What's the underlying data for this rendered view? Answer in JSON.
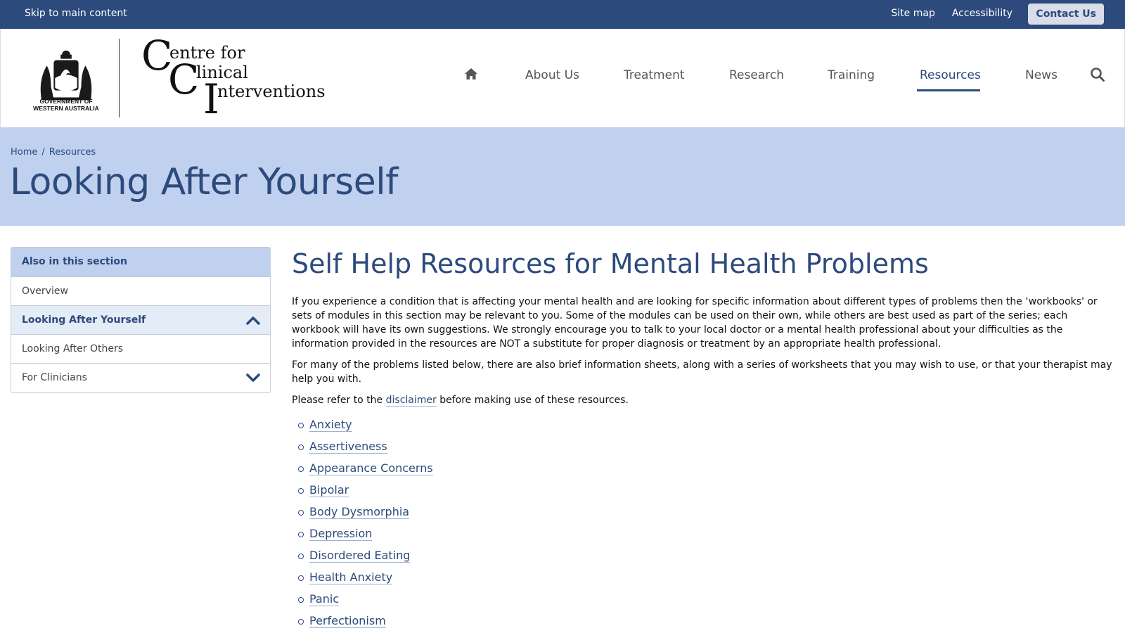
{
  "topbar": {
    "skip_link": "Skip to main content",
    "site_map": "Site map",
    "accessibility": "Accessibility",
    "contact": "Contact Us"
  },
  "logo": {
    "government_line1": "GOVERNMENT OF",
    "government_line2": "WESTERN AUSTRALIA",
    "cci_letter1": "C",
    "cci_line1": "entre for",
    "cci_letter2": "C",
    "cci_line2": "linical",
    "cci_letter3": "I",
    "cci_line3": "nterventions"
  },
  "nav": {
    "icons": [
      "home-icon",
      "search-icon"
    ],
    "items": [
      "About Us",
      "Treatment",
      "Research",
      "Training",
      "Resources",
      "News"
    ],
    "active": "Resources"
  },
  "banner": {
    "breadcrumb": [
      "Home",
      "Resources"
    ],
    "breadcrumb_separator": "/",
    "title": "Looking After Yourself"
  },
  "sidebar": {
    "heading": "Also in this section",
    "items": [
      {
        "label": "Overview",
        "icon": ""
      },
      {
        "label": "Looking After Yourself",
        "icon": "chevron-up-icon"
      },
      {
        "label": "Looking After Others",
        "icon": ""
      },
      {
        "label": "For Clinicians",
        "icon": "chevron-down-icon"
      }
    ]
  },
  "main": {
    "heading": "Self Help Resources for Mental Health Problems",
    "para1": "If you experience a condition that is affecting your mental health and are looking for specific information about different types of problems then the ‘workbooks' or sets of modules in this section may be relevant to you. Some of the modules can be used on their own, while others are best used as part of the series; each workbook will have its own suggestions. We strongly encourage you to talk to your local doctor or a mental health professional about your difficulties as the information provided in the resources are NOT a substitute for proper diagnosis or treatment by an appropriate health professional.",
    "para2": "For many of the problems listed below, there are also brief information sheets, along with a series of worksheets that you may wish to use, or that your therapist may help you with.",
    "para3_before": "Please refer to the ",
    "para3_link": "disclaimer",
    "para3_after": " before making use of these resources.",
    "resources": [
      "Anxiety",
      "Assertiveness",
      "Appearance Concerns",
      "Bipolar",
      "Body Dysmorphia",
      "Depression",
      "Disordered Eating",
      "Health Anxiety",
      "Panic",
      "Perfectionism"
    ]
  },
  "colors": {
    "brand": "#2c4a7c",
    "banner": "#bfd1ef",
    "current_item": "#e4ecf8"
  }
}
